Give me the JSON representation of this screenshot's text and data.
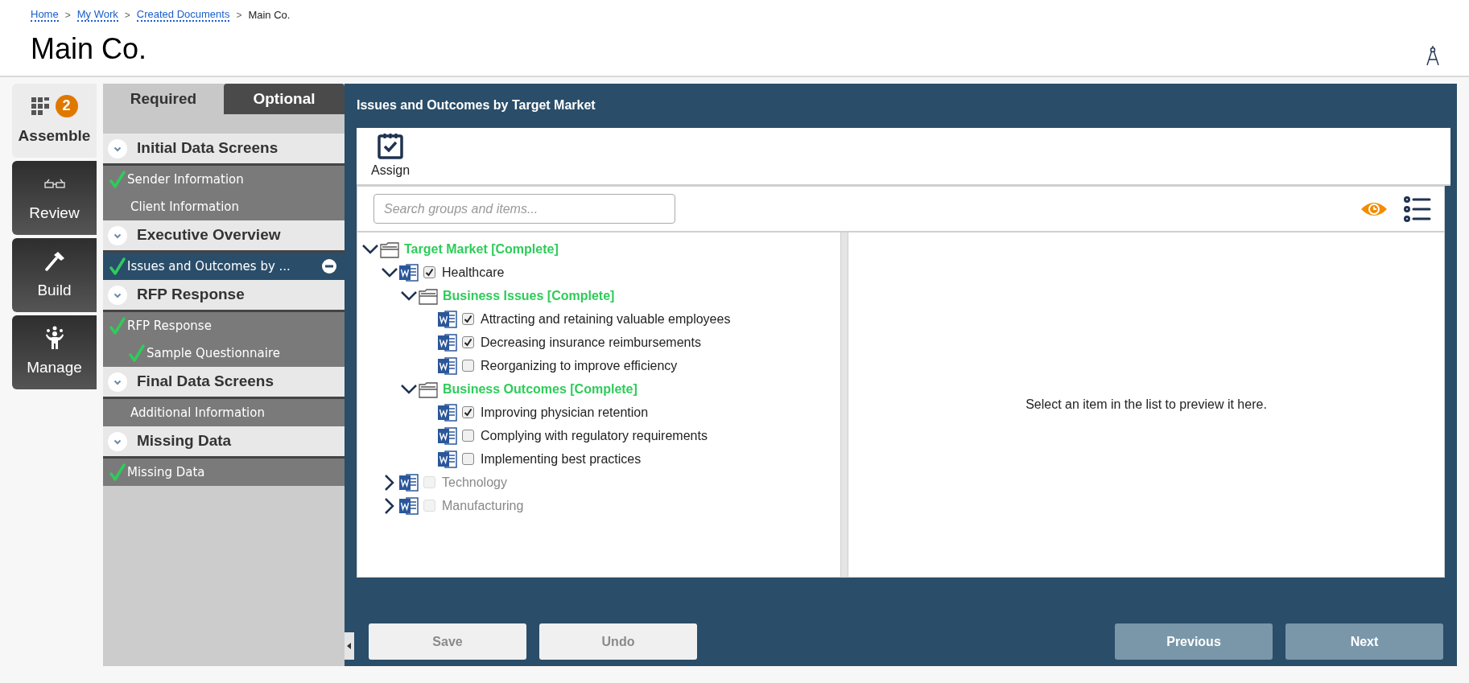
{
  "breadcrumb": [
    {
      "label": "Home",
      "link": true
    },
    {
      "separator": ">",
      "label": "My Work",
      "link": true
    },
    {
      "separator": ">",
      "label": "Created Documents",
      "link": true
    },
    {
      "separator": ">",
      "label": "Main Co.",
      "link": false
    }
  ],
  "title": "Main Co.",
  "nav": [
    {
      "label": "Assemble",
      "kind": "assemble",
      "selected": true,
      "badge": "2"
    },
    {
      "label": "Review",
      "kind": "review",
      "selected": false
    },
    {
      "label": "Build",
      "kind": "build",
      "selected": false
    },
    {
      "label": "Manage",
      "kind": "manage",
      "selected": false
    }
  ],
  "tabs": [
    {
      "label": "Required",
      "selected": true
    },
    {
      "label": "Optional",
      "selected": false
    }
  ],
  "sections": [
    {
      "title": "Initial Data Screens",
      "items": [
        {
          "label": "Sender Information",
          "done": true,
          "selected": false
        },
        {
          "label": "Client Information",
          "done": false,
          "selected": false
        }
      ]
    },
    {
      "title": "Executive Overview",
      "items": [
        {
          "label": "Issues and Outcomes by ...",
          "done": true,
          "selected": true
        }
      ]
    },
    {
      "title": "RFP Response",
      "items": [
        {
          "label": "RFP Response",
          "done": true,
          "selected": false,
          "children": [
            {
              "label": "Sample Questionnaire",
              "done": true,
              "selected": false
            }
          ]
        }
      ]
    },
    {
      "title": "Final Data Screens",
      "items": [
        {
          "label": "Additional Information",
          "done": false,
          "selected": false
        }
      ]
    },
    {
      "title": "Missing Data",
      "items": [
        {
          "label": "Missing Data",
          "done": true,
          "selected": false
        }
      ]
    }
  ],
  "panel": {
    "title": "Issues and Outcomes by Target Market",
    "toolbar": [
      {
        "label": "Assign"
      }
    ],
    "search": {
      "placeholder": "Search groups and items..."
    },
    "tree": [
      {
        "label": "Target Market [Complete]",
        "kind": "group",
        "expanded": true,
        "children": [
          {
            "label": "Healthcare",
            "kind": "document",
            "expanded": true,
            "checked": true,
            "disabled": false,
            "children": [
              {
                "label": "Business Issues [Complete]",
                "kind": "group",
                "expanded": true,
                "children": [
                  {
                    "label": "Attracting and retaining valuable employees",
                    "kind": "document",
                    "checked": true,
                    "disabled": false
                  },
                  {
                    "label": "Decreasing insurance reimbursements",
                    "kind": "document",
                    "checked": true,
                    "disabled": false
                  },
                  {
                    "label": "Reorganizing to improve efficiency",
                    "kind": "document",
                    "checked": false,
                    "disabled": false
                  }
                ]
              },
              {
                "label": "Business Outcomes [Complete]",
                "kind": "group",
                "expanded": true,
                "children": [
                  {
                    "label": "Improving physician retention",
                    "kind": "document",
                    "checked": true,
                    "disabled": false
                  },
                  {
                    "label": "Complying with regulatory requirements",
                    "kind": "document",
                    "checked": false,
                    "disabled": false
                  },
                  {
                    "label": "Implementing best practices",
                    "kind": "document",
                    "checked": false,
                    "disabled": false
                  }
                ]
              }
            ]
          },
          {
            "label": "Technology",
            "kind": "document",
            "expanded": false,
            "checked": false,
            "disabled": true
          },
          {
            "label": "Manufacturing",
            "kind": "document",
            "expanded": false,
            "checked": false,
            "disabled": true
          }
        ]
      }
    ],
    "preview": "Select an item in the list to preview it here."
  },
  "buttons": [
    {
      "label": "Save",
      "disabled": true
    },
    {
      "label": "Undo",
      "disabled": true
    },
    {
      "label": "Previous",
      "disabled": false
    },
    {
      "label": "Next",
      "disabled": false
    }
  ]
}
